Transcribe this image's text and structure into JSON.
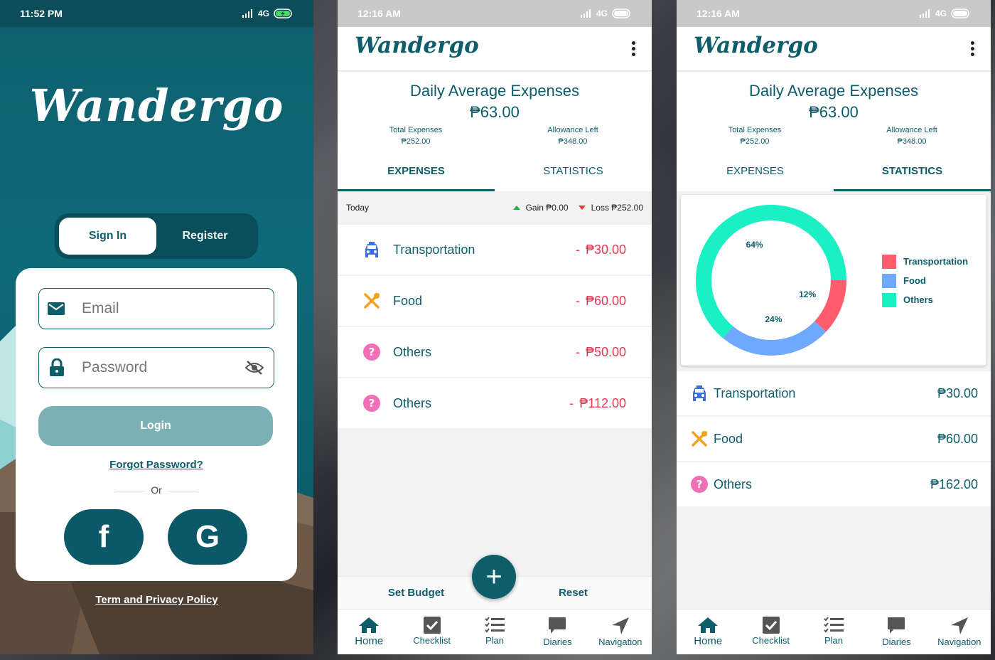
{
  "login_screen": {
    "status_time": "11:52 PM",
    "status_network": "4G",
    "logo": "Wandergo",
    "tabs": [
      "Sign In",
      "Register"
    ],
    "email_placeholder": "Email",
    "password_placeholder": "Password",
    "login_label": "Login",
    "forgot_label": "Forgot Password?",
    "or_label": "Or",
    "facebook_label": "f",
    "google_label": "G",
    "terms_label": "Term and Privacy Policy"
  },
  "expenses_screen": {
    "status_time": "12:16 AM",
    "status_network": "4G",
    "brand": "Wandergo",
    "title": "Daily Average Expenses",
    "average": "₱63.00",
    "total_label": "Total Expenses",
    "total_value": "₱252.00",
    "allowance_label": "Allowance Left",
    "allowance_value": "₱348.00",
    "tabs": [
      "EXPENSES",
      "STATISTICS"
    ],
    "day_label": "Today",
    "gain_label": "Gain ₱0.00",
    "loss_label": "Loss ₱252.00",
    "items": [
      {
        "icon": "taxi-icon",
        "label": "Transportation",
        "amount": "₱30.00"
      },
      {
        "icon": "fork-knife-icon",
        "label": "Food",
        "amount": "₱60.00"
      },
      {
        "icon": "question-icon",
        "label": "Others",
        "amount": "₱50.00"
      },
      {
        "icon": "question-icon",
        "label": "Others",
        "amount": "₱112.00"
      }
    ],
    "dash": "-",
    "set_budget_label": "Set Budget",
    "reset_label": "Reset",
    "fab_label": "+"
  },
  "statistics_screen": {
    "status_time": "12:16 AM",
    "status_network": "4G",
    "brand": "Wandergo",
    "title": "Daily Average Expenses",
    "average": "₱63.00",
    "total_label": "Total Expenses",
    "total_value": "₱252.00",
    "allowance_label": "Allowance Left",
    "allowance_value": "₱348.00",
    "tabs": [
      "EXPENSES",
      "STATISTICS"
    ],
    "items": [
      {
        "icon": "taxi-icon",
        "label": "Transportation",
        "amount": "₱30.00"
      },
      {
        "icon": "fork-knife-icon",
        "label": "Food",
        "amount": "₱60.00"
      },
      {
        "icon": "question-icon",
        "label": "Others",
        "amount": "₱162.00"
      }
    ]
  },
  "chart_data": {
    "type": "pie",
    "categories": [
      "Transportation",
      "Food",
      "Others"
    ],
    "values": [
      12,
      24,
      64
    ],
    "labels": [
      "12%",
      "24%",
      "64%"
    ],
    "colors": [
      "#ff5c6c",
      "#6ea8ff",
      "#1af0c4"
    ],
    "legend_position": "right"
  },
  "nav": [
    {
      "icon": "home-icon",
      "label": "Home"
    },
    {
      "icon": "checkbox-icon",
      "label": "Checklist"
    },
    {
      "icon": "list-icon",
      "label": "Plan"
    },
    {
      "icon": "chat-bubble-icon",
      "label": "Diaries"
    },
    {
      "icon": "navigation-arrow-icon",
      "label": "Navigation"
    }
  ],
  "colors": {
    "primary": "#0e5d6b",
    "expense_red": "#e53950"
  }
}
